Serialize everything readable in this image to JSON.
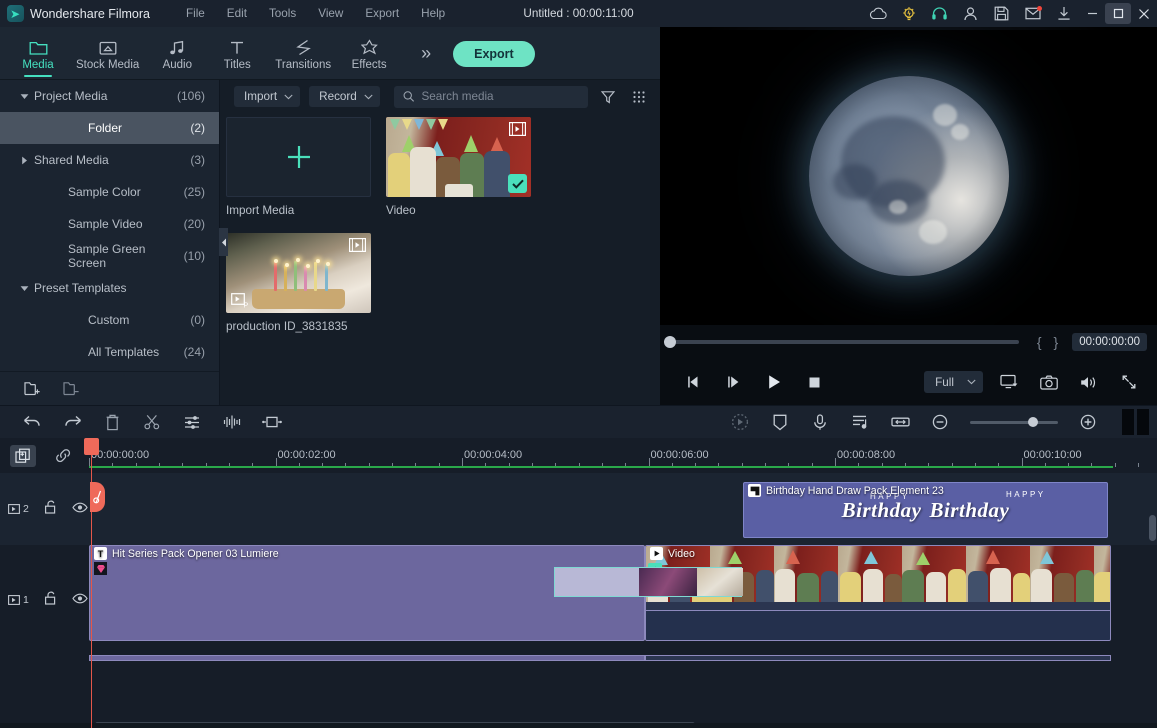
{
  "titlebar": {
    "app_name": "Wondershare Filmora",
    "menus": [
      "File",
      "Edit",
      "Tools",
      "View",
      "Export",
      "Help"
    ],
    "project_title": "Untitled : 00:00:11:00",
    "right_icons": [
      {
        "name": "cloud-icon",
        "label": "Cloud"
      },
      {
        "name": "lightbulb-icon",
        "label": "Tips"
      },
      {
        "name": "headphones-icon",
        "label": "Support"
      },
      {
        "name": "account-icon",
        "label": "Account"
      },
      {
        "name": "save-icon",
        "label": "Save"
      },
      {
        "name": "mail-icon",
        "label": "Messages"
      },
      {
        "name": "download-icon",
        "label": "Downloads"
      }
    ],
    "window_buttons": [
      "minimize",
      "maximize",
      "close"
    ]
  },
  "ribbon": {
    "tabs": [
      {
        "label": "Media",
        "icon": "folder-icon",
        "selected": true
      },
      {
        "label": "Stock Media",
        "icon": "stock-media-icon",
        "selected": false
      },
      {
        "label": "Audio",
        "icon": "audio-note-icon",
        "selected": false
      },
      {
        "label": "Titles",
        "icon": "titles-t-icon",
        "selected": false
      },
      {
        "label": "Transitions",
        "icon": "transitions-icon",
        "selected": false
      },
      {
        "label": "Effects",
        "icon": "effects-star-icon",
        "selected": false
      }
    ],
    "more_label": "»",
    "export_label": "Export",
    "accent_color": "#6ee3c4"
  },
  "library": {
    "items": [
      {
        "label": "Project Media",
        "count": "(106)",
        "arrow": "down",
        "selected": false,
        "indent": 0
      },
      {
        "label": "Folder",
        "count": "(2)",
        "arrow": "none",
        "selected": true,
        "indent": 1
      },
      {
        "label": "Shared Media",
        "count": "(3)",
        "arrow": "right",
        "selected": false,
        "indent": 0
      },
      {
        "label": "Sample Color",
        "count": "(25)",
        "arrow": "none",
        "selected": false,
        "indent": 2
      },
      {
        "label": "Sample Video",
        "count": "(20)",
        "arrow": "none",
        "selected": false,
        "indent": 2
      },
      {
        "label": "Sample Green Screen",
        "count": "(10)",
        "arrow": "none",
        "selected": false,
        "indent": 2
      },
      {
        "label": "Preset Templates",
        "count": "",
        "arrow": "down",
        "selected": false,
        "indent": 0
      },
      {
        "label": "Custom",
        "count": "(0)",
        "arrow": "none",
        "selected": false,
        "indent": 1
      },
      {
        "label": "All Templates",
        "count": "(24)",
        "arrow": "none",
        "selected": false,
        "indent": 1
      }
    ],
    "footer": [
      {
        "name": "new-folder-icon",
        "label": "New Folder"
      },
      {
        "name": "remove-folder-icon",
        "label": "Remove Folder"
      }
    ]
  },
  "media_toolbar": {
    "import_label": "Import",
    "record_label": "Record",
    "search_placeholder": "Search media",
    "search_value": "",
    "filter_icon": "filter-icon",
    "grid_icon": "grid-view-icon"
  },
  "media_items": [
    {
      "caption": "Import Media",
      "type": "import-placeholder",
      "selected": false
    },
    {
      "caption": "Video",
      "type": "video-thumb-party",
      "selected": true
    },
    {
      "caption": "production ID_3831835",
      "type": "video-thumb-cake",
      "selected": false
    }
  ],
  "player": {
    "scrub_position_pct": 0,
    "mark_in_label": "{",
    "mark_out_label": "}",
    "timecode": "00:00:00:00",
    "controls": [
      {
        "name": "prev-frame-button",
        "label": "Previous frame"
      },
      {
        "name": "next-frame-button",
        "label": "Next frame"
      },
      {
        "name": "play-button",
        "label": "Play"
      },
      {
        "name": "stop-button",
        "label": "Stop"
      }
    ],
    "quality_label": "Full",
    "right_controls": [
      {
        "name": "display-settings-icon",
        "label": "Display"
      },
      {
        "name": "snapshot-camera-icon",
        "label": "Snapshot"
      },
      {
        "name": "volume-icon",
        "label": "Volume"
      },
      {
        "name": "fullscreen-icon",
        "label": "Fullscreen"
      }
    ]
  },
  "timeline_toolbar": {
    "left_icons": [
      {
        "name": "undo-icon",
        "label": "Undo"
      },
      {
        "name": "redo-icon",
        "label": "Redo"
      },
      {
        "name": "delete-icon",
        "label": "Delete"
      },
      {
        "name": "split-scissors-icon",
        "label": "Split"
      },
      {
        "name": "color-settings-icon",
        "label": "Adjust"
      },
      {
        "name": "audio-waveform-icon",
        "label": "Audio"
      },
      {
        "name": "crop-icon",
        "label": "Crop"
      }
    ],
    "right_icons": [
      {
        "name": "render-preview-icon",
        "label": "Render Preview"
      },
      {
        "name": "marker-icon",
        "label": "Marker"
      },
      {
        "name": "voiceover-mic-icon",
        "label": "Record Voiceover"
      },
      {
        "name": "audio-mixer-icon",
        "label": "Audio Mixer"
      },
      {
        "name": "fit-timeline-icon",
        "label": "Fit to Timeline"
      }
    ],
    "zoom_out_label": "−",
    "zoom_in_label": "+",
    "zoom_value_pct": 72
  },
  "timeline": {
    "header_buttons": [
      {
        "name": "auto-ripple-icon",
        "label": "Auto Ripple",
        "active": true
      },
      {
        "name": "link-icon",
        "label": "Link",
        "active": false
      }
    ],
    "ruler_labels": [
      "00:00:00:00",
      "00:00:02:00",
      "00:00:04:00",
      "00:00:06:00",
      "00:00:08:00",
      "00:00:10:00"
    ],
    "playhead_timecode": "00:00:00:00",
    "tracks": [
      {
        "number": "2",
        "lock_icon": "unlock-icon",
        "eye_icon": "eye-icon",
        "clips": [
          {
            "name": "Birthday Hand Draw Pack Element 23",
            "type": "element",
            "icon": "element-icon",
            "left_pct": 61.3,
            "width_pct": 34.2,
            "art_words": [
              "Birthday",
              "Birthday"
            ],
            "art_small": "HAPPY"
          }
        ]
      },
      {
        "number": "1",
        "lock_icon": "unlock-icon",
        "eye_icon": "eye-icon",
        "clips": [
          {
            "name": "Hit Series Pack Opener 03 Lumiere",
            "type": "title",
            "icon": "title-t-icon",
            "left_pct": 0,
            "width_pct": 52.0
          },
          {
            "name": "Video",
            "type": "video",
            "icon": "play-icon",
            "left_pct": 52.0,
            "width_pct": 44.2
          }
        ]
      }
    ]
  },
  "colors": {
    "accent": "#6ee3c4",
    "window_bg": "#16202b",
    "panel_bg": "#1b2430",
    "titlebar_bg": "#1a222e",
    "playhead": "#e4574a",
    "ruler_green": "#2aa84a",
    "clip_element": "#5a5fa4",
    "clip_title": "#6c679e",
    "clip_video": "#2b3550"
  }
}
